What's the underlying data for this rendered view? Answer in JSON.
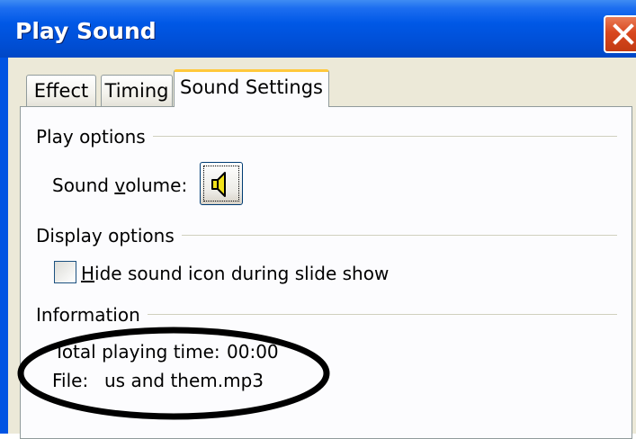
{
  "window": {
    "title": "Play Sound"
  },
  "tabs": [
    {
      "label": "Effect",
      "active": false
    },
    {
      "label": "Timing",
      "active": false
    },
    {
      "label": "Sound Settings",
      "active": true
    }
  ],
  "play_options": {
    "group_label": "Play options",
    "volume_label_pre": "Sound ",
    "volume_label_accel": "v",
    "volume_label_post": "olume:",
    "volume_icon": "speaker-icon"
  },
  "display_options": {
    "group_label": "Display options",
    "checkbox_accel": "H",
    "checkbox_label_rest": "ide sound icon during slide show",
    "checkbox_checked": false
  },
  "information": {
    "group_label": "Information",
    "total_time_label": "Total playing time:",
    "total_time_value": "00:00",
    "file_label": "File:",
    "file_value": "us and them.mp3"
  },
  "colors": {
    "titlebar": "#0054e3",
    "dialog_bg": "#ece9d8",
    "panel_bg": "#fcfcfe",
    "active_tab_accent": "#ffc83c",
    "close_button": "#d9481f",
    "annotation_oval": "#000000"
  }
}
